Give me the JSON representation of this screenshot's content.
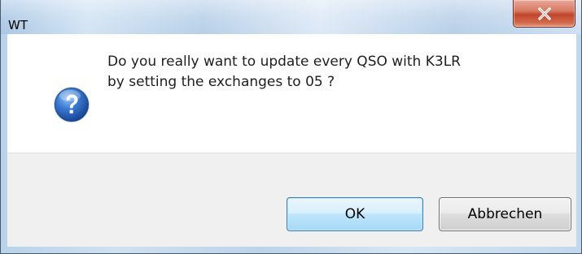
{
  "window": {
    "title": "WT",
    "close_icon": "close-icon"
  },
  "dialog": {
    "icon": "question-icon",
    "message_line1": "Do you really want to update every QSO with K3LR",
    "message_line2": "by setting the exchanges to 05 ?"
  },
  "buttons": {
    "ok_label": "OK",
    "cancel_label": "Abbrechen"
  },
  "colors": {
    "close_button": "#c9513a",
    "icon_blue": "#2a5fb5",
    "ok_border": "#3c7fb1"
  }
}
